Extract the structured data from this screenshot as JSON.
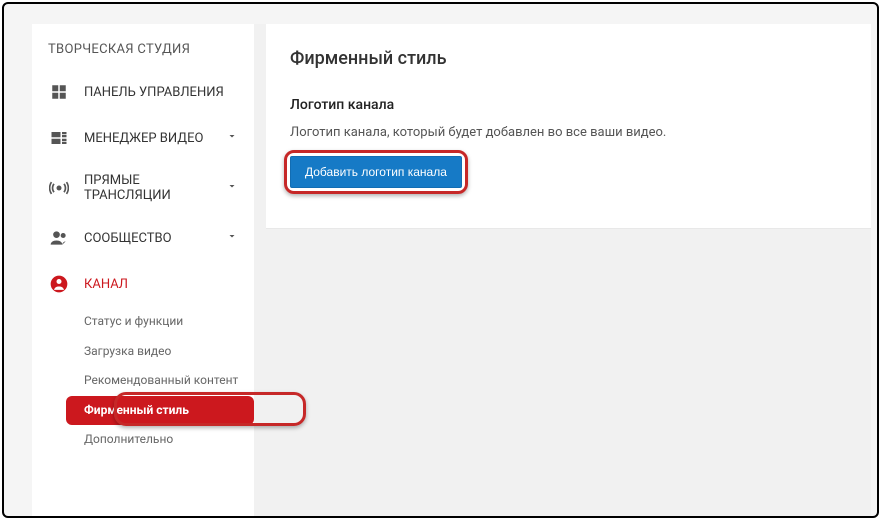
{
  "sidebar": {
    "title": "ТВОРЧЕСКАЯ СТУДИЯ",
    "items": [
      {
        "label": "ПАНЕЛЬ УПРАВЛЕНИЯ"
      },
      {
        "label": "МЕНЕДЖЕР ВИДЕО"
      },
      {
        "label": "ПРЯМЫЕ ТРАНСЛЯЦИИ"
      },
      {
        "label": "СООБЩЕСТВО"
      },
      {
        "label": "КАНАЛ"
      }
    ],
    "channel_sub": [
      {
        "label": "Статус и функции"
      },
      {
        "label": "Загрузка видео"
      },
      {
        "label": "Рекомендованный контент"
      },
      {
        "label": "Фирменный стиль"
      },
      {
        "label": "Дополнительно"
      }
    ]
  },
  "main": {
    "page_title": "Фирменный стиль",
    "section_title": "Логотип канала",
    "section_desc": "Логотип канала, который будет добавлен во все ваши видео.",
    "add_button": "Добавить логотип канала"
  }
}
